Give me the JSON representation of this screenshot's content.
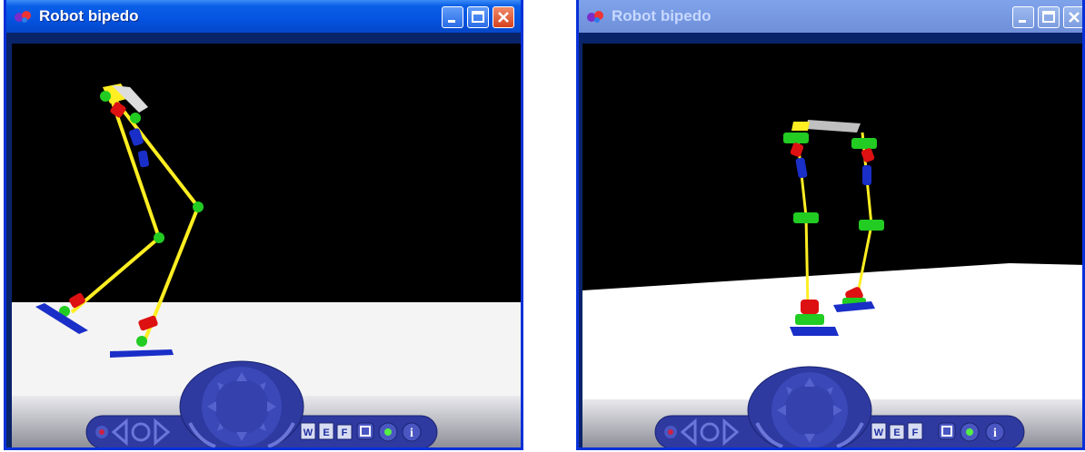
{
  "windows": [
    {
      "title": "Robot bipedo"
    },
    {
      "title": "Robot bipedo"
    }
  ],
  "navbar": {
    "buttons": {
      "world": "W",
      "entity": "E",
      "fit": "F",
      "info": "i"
    }
  },
  "colors": {
    "titlebar_active": "#0554e3",
    "viewport_bg": "#000000",
    "ground": "#ffffff",
    "limb_yellow": "#ffee22",
    "joint_green": "#22cc22",
    "joint_red": "#dd1111",
    "joint_blue": "#1a2ec8",
    "navbar": "#2e3aa0"
  }
}
